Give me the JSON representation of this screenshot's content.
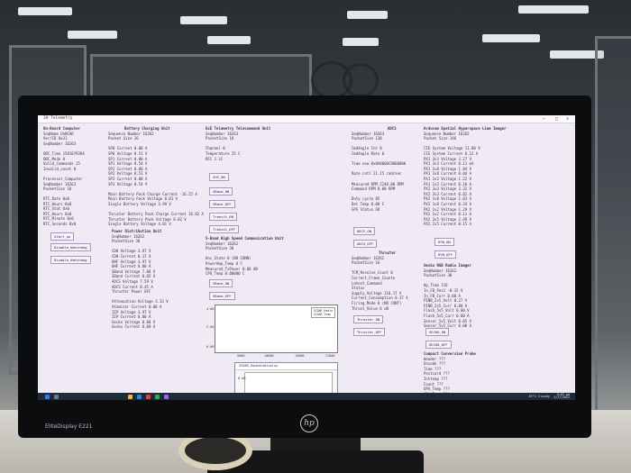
{
  "scene": {
    "monitor_brand": "EliteDisplay E221",
    "hp_logo": "hp"
  },
  "window": {
    "title": "3U Telemetry",
    "controls": [
      "—",
      "□",
      "✕"
    ]
  },
  "panels": {
    "onboard_computer": {
      "header": "On-Board Computer",
      "lines": [
        "SeqName        OnBCAR",
        "Ver/ID         0x31",
        "SeqNumber      16263",
        "",
        "OBC_Time       1581879384",
        "OBC_Mode       0",
        "Valid_Commands 25",
        "Invalid_count  0",
        "",
        "Processor_Computer",
        "SeqNumber      16263",
        "PacketSize     18"
      ],
      "lines_lower": [
        "RTC_Date      0x0",
        "RTC_Hours     0x0",
        "RTC_Stat      0x0",
        "RTC_Hours     0x0",
        "RTC_Minute    0x0",
        "RTC_Seconds   0x0"
      ],
      "buttons": [
        "Start_up",
        "Disable_Watchdog",
        "Disable_Watchdog"
      ]
    },
    "battery": {
      "header": "Battery Charging Unit",
      "lines": [
        "Sequence Number       16262",
        "Packet Size           26",
        "",
        "SP0 Current           0.00 A",
        "SP0 Voltage           0.51 V",
        "SP1 Current           0.00 A",
        "SP1 Voltage           0.54 V",
        "SP2 Current           0.00 A",
        "SP2 Voltage           0.51 V",
        "SP3 Current           0.00 A",
        "SP3 Voltage           0.54 V",
        "",
        "Main Battery Pack Charge Current   -16.25 A",
        "Main Battery Pack Voltage           8.01 V",
        "Single Battery Voltage              3.99 V",
        "",
        "Thruster Battery Pack Charge Current  16.02 A",
        "Thruster Battery Pack Voltage         8.02 V",
        "Single Battery Voltage                4.01 V"
      ],
      "power_header": "Power Distribution Unit",
      "power_lines": [
        "SeqNumber        16262",
        "PacketSize       38",
        "",
        "CDH Voltage          3.97 V",
        "CDH Current          0.17 A",
        "UHF Voltage          3.97 V",
        "UHF Current          0.00 A",
        "SBand Voltage        7.88 V",
        "SBand Current        0.05 A",
        "ADCS Voltage         7.59 V",
        "ADCS Current         0.45 A",
        "Thruster Power       OFF",
        "",
        "Attenuation Voltage  3.33 V",
        "Atomizer Current     0.00 A",
        "IIP Voltage          3.97 V",
        "IIP Current          0.00 A",
        "Gecko Voltage        0.00 V",
        "Gecko Current        0.00 A"
      ]
    },
    "sband": {
      "header": "ExE Telemetry Telecommand Unit",
      "lines": [
        "SeqNumber    16263",
        "PacketSize   18",
        "",
        "Channel      0",
        "Temperature  25 C",
        "RFC          1  LC"
      ],
      "buttons": [
        "SHF_ON",
        "SBand_ON",
        "SBand_OFF",
        "Transit_ON",
        "Transit_OFF"
      ],
      "comm_header": "S-Band High Speed Communication Unit",
      "comm_lines": [
        "SeqNumber    16262",
        "PacketSize   38",
        "",
        "Unc_State          0 (NO CONN)",
        "PowerAmp_Temp      0 C",
        "Measured_TxPower   0.00 dB",
        "CPU_Temp           0.00000 C"
      ],
      "buttons2": [
        "SBand_ON",
        "SBand_OFF"
      ]
    },
    "adcs": {
      "header": "ADCS",
      "lines": [
        "SeqNumber     16263",
        "PacketSize    138",
        "",
        "CmdAngle Cnt     0",
        "CmdAngle Rate    0",
        "",
        "Time now     0x0A0000C8000000",
        "",
        "Rate cntl    21.15 rad/sec",
        "",
        "Measured RPM   2240.00 RPM",
        "Command RPM    0.00 RPM",
        "",
        "Duty cycle    05",
        "Det Temp      0.00 C",
        "GPS Status    GD"
      ],
      "buttons": [
        "ADCS_ON",
        "ADCS_OFF"
      ],
      "thruster_header": "Thruster",
      "thruster_lines": [
        "SeqNumber      16262",
        "PacketSize     16",
        "",
        "TCM_Resolve_Count   0",
        "Correct_Frame_Counte",
        "Latest_Command",
        "Status",
        "Supply_Voltage       110.17 V",
        "Current_Consumption  0.37 A",
        "Firing_Mode          0 (NO CONT)",
        "Thrust_Value         0 uN"
      ],
      "buttons2": [
        "Thruster_ON",
        "Thruster_OFF"
      ]
    },
    "imager": {
      "header": "Arducam Spatial Hyperspace Lime Imager",
      "lines": [
        "Sequence Number     16262",
        "Packet Size         146",
        "",
        "CIE System Voltage    11.00 V",
        "CIE System Current    0.12 A",
        "PX1 3v3 Voltage       3.27 V",
        "PX1 3v3 Current       0.11 mA",
        "PX1 1v8 Voltage       1.84 V",
        "PX1 1v8 Current       0.04 A",
        "PX1 1v2 Voltage       1.22 V",
        "PX1 1v2 Current       0.10 A",
        "PX2 3v3 Voltage       3.32 V",
        "PX2 3v3 Current       0.01 A",
        "PX2 1v8 Voltage       1.83 V",
        "PX2 1v8 Current       0.34 A",
        "PX2 1v2 Voltage       1.29 V",
        "PX2 1v2 Current       0.11 A",
        "PX2 2v5 Voltage       2.49 V",
        "PX2 2v5 Current       0.15 A"
      ],
      "buttons": [
        "HYN_ON",
        "HYN_OFF"
      ],
      "gecko_header": "Gecko RGB Radio Imager",
      "gecko_lines": [
        "SeqNumber     16262",
        "PacketSize    38",
        "",
        "Hp_Time       116",
        "In_FB_Pos1    -0.15 V",
        "In_FB_Curr    0.00 A",
        "PINB_2v5_Volt 0.27 V",
        "PINB_2v5_Curr 0.00 A",
        "Flash_5v5_Volt 0.00 V",
        "Flash_5v5_Curr 0.00 A",
        "Sensor_5v5_Volt 0.05 V",
        "Sensor_5v5_Curr 0.00 A"
      ],
      "buttons2": [
        "GECKO_ON",
        "GECKO_OFF"
      ],
      "compact_header": "Compact Conversion Probe",
      "compact_lines": [
        "Header    ???",
        "Uncode    ???",
        "Time      ???",
        "Postcard ???",
        "Inttemp  ???",
        "Count    ???",
        "UPA_Temp ???",
        "UPA_Temp ???"
      ]
    }
  },
  "plot": {
    "y_ticks": [
      "4.00",
      "2.00",
      "0.00"
    ],
    "x_ticks": [
      "5000",
      "10000",
      "15000",
      "21000"
    ],
    "legend": [
      "SCDAR_Radio",
      "SCDAR_Temp"
    ]
  },
  "subwindow": {
    "title": "SCDAR_RawDataDisplay",
    "y_tick": "0.00"
  },
  "taskbar": {
    "weather": "25°C Cloudy",
    "time": "8:01 pm",
    "date": "2/17/2022"
  },
  "colors": {
    "screen_bg": "#f0eaf4",
    "text": "#3a3446",
    "taskbar": "#1f2a3a"
  }
}
